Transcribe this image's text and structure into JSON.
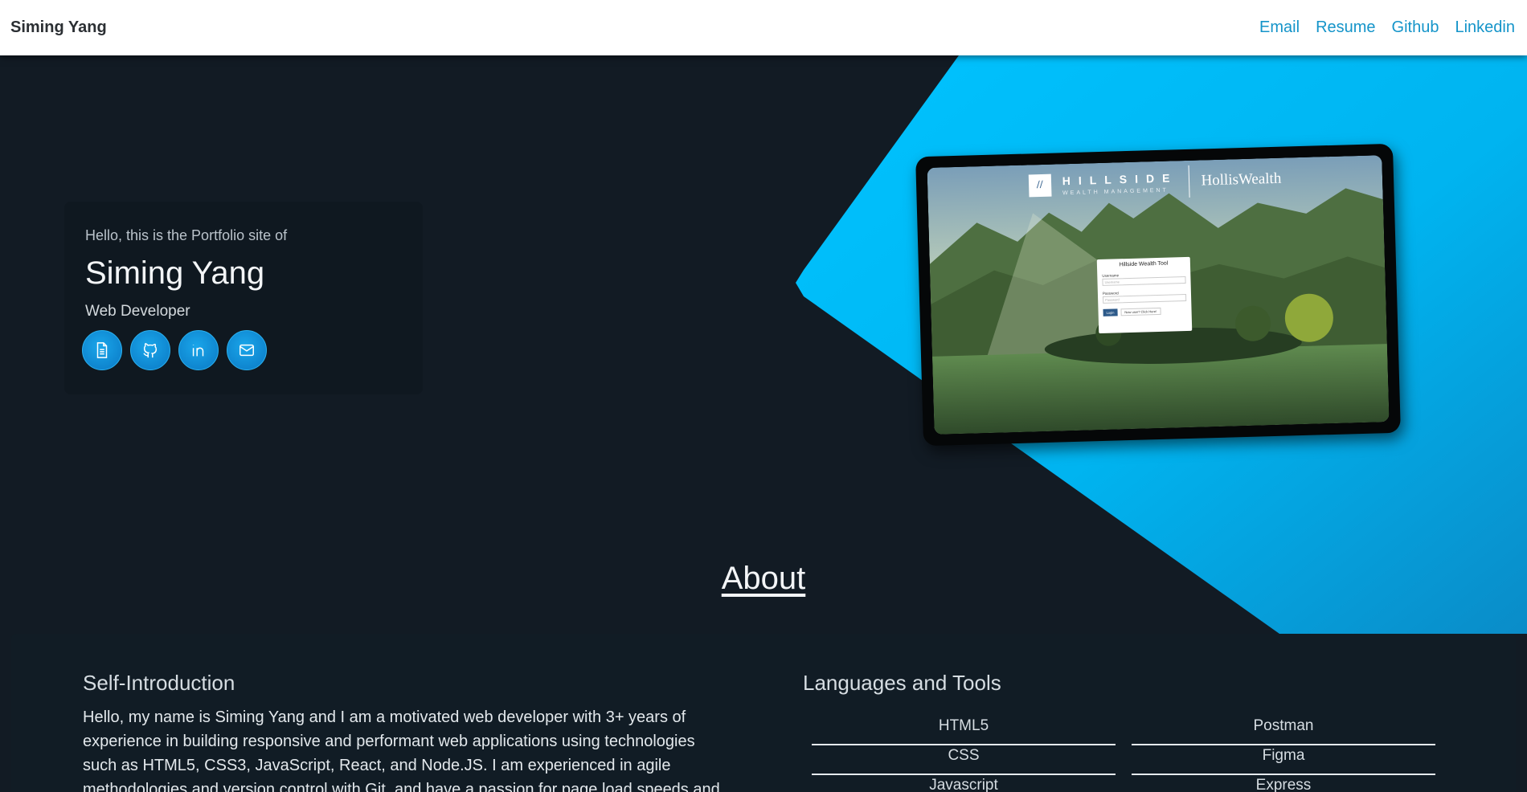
{
  "navbar": {
    "brand": "Siming Yang",
    "links": [
      "Email",
      "Resume",
      "Github",
      "Linkedin"
    ]
  },
  "hero": {
    "greeting": "Hello, this is the Portfolio site of",
    "name": "Siming Yang",
    "role": "Web Developer",
    "social_icons": [
      "resume-document-icon",
      "github-icon",
      "linkedin-icon",
      "email-envelope-icon"
    ],
    "accent_color": "#00a8e8"
  },
  "tablet_preview": {
    "logo_mark": "//",
    "logo_text": "HILLSIDE",
    "logo_sub": "WEALTH MANAGEMENT",
    "partner_logo": "HollisWealth",
    "login": {
      "title": "Hillside Wealth Tool",
      "username_label": "Username",
      "username_placeholder": "Username",
      "password_label": "Password",
      "password_placeholder": "Password",
      "login_button": "Login",
      "new_user_button": "New user? Click Here!"
    }
  },
  "about": {
    "title": "About",
    "self_intro_title": "Self-Introduction",
    "self_intro_body": "Hello, my name is Siming Yang and I am a motivated web developer with 3+ years of experience in building responsive and performant web applications using technologies such as HTML5, CSS3, JavaScript, React, and Node.JS. I am experienced in agile methodologies and version control with Git, and have a passion for page load speeds and",
    "languages_title": "Languages and Tools",
    "tools_left": [
      "HTML5",
      "CSS",
      "Javascript"
    ],
    "tools_right": [
      "Postman",
      "Figma",
      "Express"
    ]
  }
}
